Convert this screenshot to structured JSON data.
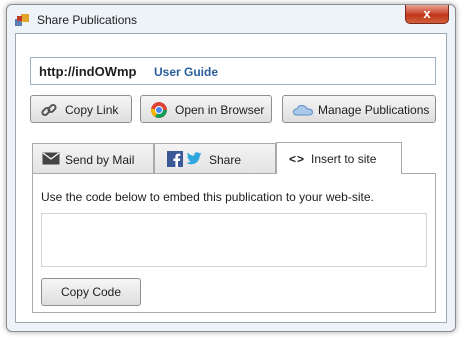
{
  "window": {
    "title": "Share Publications",
    "close_label": "x"
  },
  "url": {
    "value": "http://indOWmp",
    "guide_label": "User Guide"
  },
  "actions": {
    "copy_link": "Copy Link",
    "open_browser": "Open in Browser",
    "manage": "Manage Publications"
  },
  "tabs": {
    "mail": "Send by Mail",
    "share": "Share",
    "insert": "Insert to site",
    "insert_icon_text": "<>"
  },
  "embed": {
    "description": "Use the code below to embed this publication to your web-site.",
    "code_value": "",
    "copy_button": "Copy Code"
  },
  "icons": {
    "app": "share-publications-app-icon",
    "copy_link": "chain-link-icon",
    "open_browser": "chrome-browser-icon",
    "manage": "cloud-icon",
    "mail": "envelope-icon",
    "facebook": "facebook-icon",
    "twitter": "twitter-bird-icon",
    "insert": "code-brackets-icon"
  },
  "colors": {
    "link": "#2a5f9e",
    "close": "#c8472f",
    "facebook": "#3b5998",
    "twitter": "#2fa6e0"
  }
}
